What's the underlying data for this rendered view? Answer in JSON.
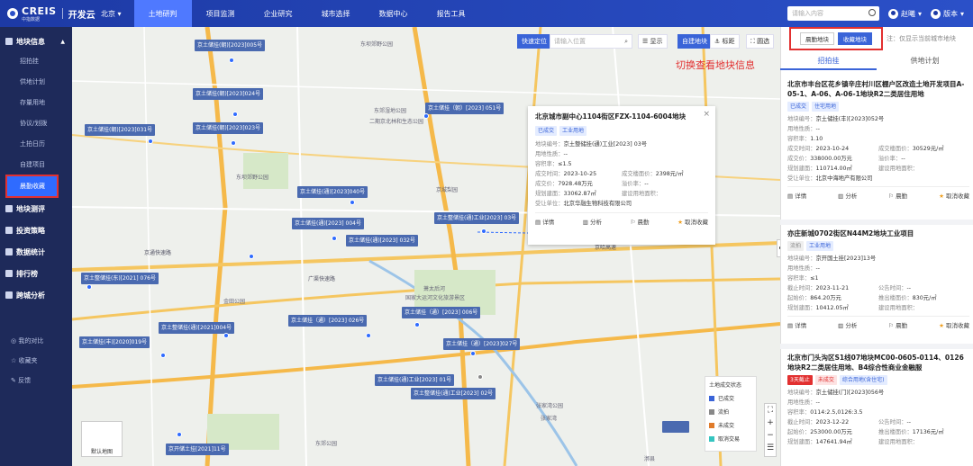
{
  "header": {
    "brand": "CREIS",
    "brand_sub": "中指数据",
    "app": "开发云",
    "city": "北京",
    "nav": [
      "土地研判",
      "项目监测",
      "企业研究",
      "城市选择",
      "数据中心",
      "报告工具"
    ],
    "search_placeholder": "请输入内容",
    "user": "赵曦",
    "version": "版本"
  },
  "sidebar": {
    "group1": "地块信息",
    "items": [
      "招拍挂",
      "供地计划",
      "存量用地",
      "协议/划拨",
      "土拍日历",
      "自建项目",
      "晨勤收藏"
    ],
    "groups": [
      "地块测评",
      "投资策略",
      "数据统计",
      "排行榜",
      "跨城分析"
    ],
    "bottom": [
      "我的对比",
      "收藏夹",
      "反馈"
    ]
  },
  "map": {
    "tools": {
      "locate": "快速定位",
      "search_placeholder": "请输入位置",
      "show": "显示",
      "self": "自建地块",
      "measure": "标距",
      "circle": "圆选"
    },
    "labels": [
      {
        "t": "京土储挂(朝)[2023]005号"
      },
      {
        "t": "京土储挂(朝)[2023]024号"
      },
      {
        "t": "京土储挂(朝)[2023]023号"
      },
      {
        "t": "京土储挂(朝)[2023]031号"
      },
      {
        "t": "京土储挂（朝）[2023] 051号"
      },
      {
        "t": "京土储挂(通)[2023]040号"
      },
      {
        "t": "京土储挂(通)[2023] 004号"
      },
      {
        "t": "京土储挂(通)[2023] 032号"
      },
      {
        "t": "京土整储挂(通)工业[2023] 03号"
      },
      {
        "t": "京土整储挂(东)[2021] 076号"
      },
      {
        "t": "京土整储挂(通)[2021]004号"
      },
      {
        "t": "京土储挂（通）[2023] 026号"
      },
      {
        "t": "京土储挂（通）[2023] 006号"
      },
      {
        "t": "京土储挂(丰)[2020]019号"
      },
      {
        "t": "京土储挂（通）[2023]027号"
      },
      {
        "t": "京土储挂(通)工业[2023] 01号"
      },
      {
        "t": "京土整储挂(通)工业[2023] 02号"
      },
      {
        "t": "京开储土挂[2021]11号"
      }
    ],
    "places": [
      "东坝郊野公园",
      "东郊湿地公园",
      "东部森林公园",
      "东坝郊野公园",
      "京城梨园",
      "二期京北林和生态公园",
      "萧太后河",
      "国家大运河文化旅游景区",
      "金田公园",
      "张家湾公园",
      "东郊公园",
      "张家湾",
      "漷县"
    ],
    "roads": [
      "京通快速路",
      "广渠快速路",
      "京哈高速",
      "东六环路",
      "京津高速"
    ],
    "popup": {
      "title": "北京城市副中心1104街区FZX-1104-6004地块",
      "tags": [
        "已成交",
        "工业用地"
      ],
      "num_label": "地块编号：",
      "num": "京土整储挂(通)工业[2023] 03号",
      "nature_label": "用地性质：",
      "nature": "--",
      "far_label": "容积率：",
      "far": "≤1.5",
      "deal_time_label": "成交时间：",
      "deal_time": "2023-10-25",
      "unit_price_label": "成交楼面价：",
      "unit_price": "2398元/㎡",
      "deal_price_label": "成交价：",
      "deal_price": "7928.48万元",
      "premium_label": "溢价率：",
      "premium": "--",
      "area_label": "规划建面：",
      "area": "33062.87㎡",
      "build_label": "建设用地面积：",
      "build": "",
      "winner_label": "受让单位：",
      "winner": "北京华融生物科技有限公司",
      "actions": [
        "详情",
        "分析",
        "晨勤",
        "取消收藏"
      ]
    },
    "legend": {
      "title": "土地成交状态",
      "items": [
        "已成交",
        "流拍",
        "未成交",
        "取消交易"
      ],
      "colors": [
        "#3a64d8",
        "#888888",
        "#e07b2a",
        "#35c5c0"
      ]
    },
    "minimap": "默认地图"
  },
  "panel": {
    "switch": [
      "晨勤地块",
      "收藏地块"
    ],
    "note": "注：仅显示当前城市地块",
    "annotation": "切换查看地块信息",
    "tabs": [
      "招拍挂",
      "供地计划"
    ],
    "cards": [
      {
        "title": "北京市丰台区花乡镇辛庄村川区棚户区改造土地开发项目A-05-1、A-06、A-06-1地块R2二类居住用地",
        "tags": [
          "已成交",
          "住宅用地"
        ],
        "rows": [
          [
            "地块编号：",
            "京土储挂(丰)[2023]052号"
          ],
          [
            "用地性质：",
            "--"
          ],
          [
            "容积率：",
            "1.10"
          ]
        ],
        "grid": [
          [
            "成交时间：",
            "2023-10-24"
          ],
          [
            "成交楼面价：",
            "30529元/㎡"
          ],
          [
            "成交价：",
            "338000.00万元"
          ],
          [
            "溢价率：",
            "--"
          ],
          [
            "规划建面：",
            "110714.00㎡"
          ],
          [
            "建设用地面积：",
            ""
          ]
        ],
        "winner": [
          "受让单位：",
          "北京中海地产有限公司"
        ],
        "actions": [
          "详情",
          "分析",
          "晨勤",
          "取消收藏"
        ]
      },
      {
        "title": "亦庄新城0702街区N44M2地块工业项目",
        "tags": [
          "流拍",
          "工业用地"
        ],
        "rows": [
          [
            "地块编号：",
            "京开国土挂[2023]13号"
          ],
          [
            "用地性质：",
            "--"
          ],
          [
            "容积率：",
            "≤1"
          ]
        ],
        "grid": [
          [
            "截止时间：",
            "2023-11-21"
          ],
          [
            "公告时间：",
            "--"
          ],
          [
            "起始价：",
            "864.20万元"
          ],
          [
            "推出楼面价：",
            "830元/㎡"
          ],
          [
            "规划建面：",
            "10412.05㎡"
          ],
          [
            "建设用地面积：",
            ""
          ]
        ],
        "actions": [
          "详情",
          "分析",
          "晨勤",
          "取消收藏"
        ]
      },
      {
        "title": "北京市门头沟区S1线07地块MC00-0605-0114、0126地块R2二类居住用地、B4综合性商业金融服",
        "tags": [
          "3天截止",
          "未成交",
          "综合用地(含住宅)"
        ],
        "rows": [
          [
            "地块编号：",
            "京土储挂(门)[2023]056号"
          ],
          [
            "用地性质：",
            "--"
          ],
          [
            "容积率：",
            "0114:2.5,0126:3.5"
          ]
        ],
        "grid": [
          [
            "截止时间：",
            "2023-12-22"
          ],
          [
            "公告时间：",
            "--"
          ],
          [
            "起始价：",
            "253000.00万元"
          ],
          [
            "推出楼面价：",
            "17136元/㎡"
          ],
          [
            "规划建面：",
            "147641.94㎡"
          ],
          [
            "建设用地面积：",
            ""
          ]
        ]
      }
    ]
  }
}
